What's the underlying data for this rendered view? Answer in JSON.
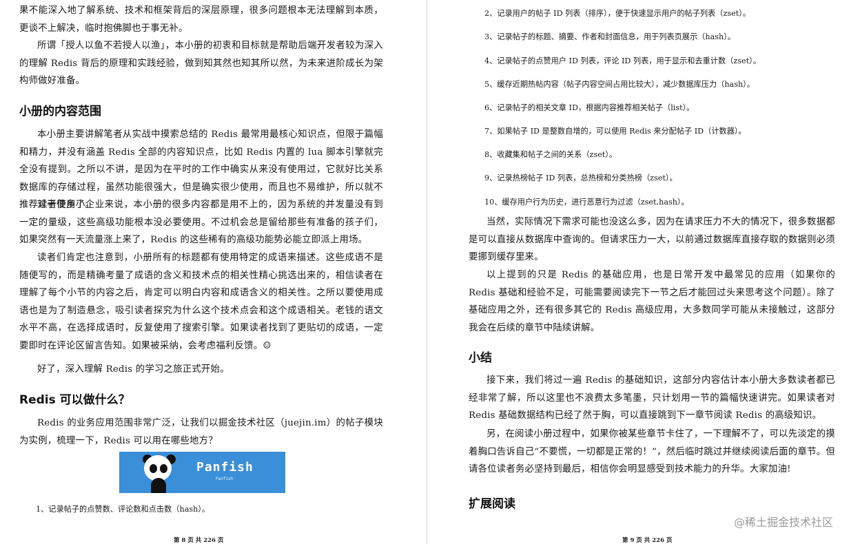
{
  "left": {
    "p1": "果不能深入地了解系统、技术和框架背后的深层原理，很多问题根本无法理解到本质，更谈不上解决，临时抱佛脚也于事无补。",
    "p2": "所谓「授人以鱼不若授人以渔」，本小册的初衷和目标就是帮助后端开发者较为深入的理解 Redis 背后的原理和实践经验，做到知其然也知其所以然，为未来进阶成长为架构师做好准备。",
    "h_scope": "小册的内容范围",
    "p3": "本小册主要讲解笔者从实战中摸索总结的 Redis 最常用最核心知识点，但限于篇幅和精力，并没有涵盖 Redis 全部的内容知识点，比如 Redis 内置的 lua 脚本引擎就完全没有提到。之所以不讲，是因为在平时的工作中确实从来没有使用过，它就好比关系数据库的存储过程，虽然功能很强大，但是确实很少使用，而且也不易维护，所以就不推荐读者使用了。",
    "p4": "对于很多小企业来说，本小册的很多内容都是用不上的，因为系统的并发量没有到一定的量级，这些高级功能根本没必要使用。不过机会总是留给那些有准备的孩子们，如果突然有一天流量涨上来了，Redis 的这些稀有的高级功能势必能立即派上用场。",
    "p5": "读者们肯定也注意到，小册所有的标题都有使用特定的成语来描述。这些成语不是随便写的，而是精确考量了成语的含义和技术点的相关性精心挑选出来的，相信读者在理解了每个小节的内容之后，肯定可以明白内容和成语含义的相关性。之所以要使用成语也是为了制造悬念，吸引读者探究为什么这个技术点会和这个成语相关。老钱的语文水平不高，在选择成语时，反复使用了搜索引擎。如果读者找到了更贴切的成语，一定要即时在评论区留言告知。如果被采纳，会考虑福利反馈。☺",
    "p6": "好了，深入理解 Redis 的学习之旅正式开始。",
    "h_usage": "Redis 可以做什么？",
    "p7": "Redis 的业务应用范围非常广泛，让我们以掘金技术社区（juejin.im）的帖子模块为实例，梳理一下，Redis 可以用在哪些地方？",
    "banner_brand": "Panfish",
    "banner_sub": "Panfish",
    "item1": "1、记录帖子的点赞数、评论数和点击数（hash）。",
    "page_num": "第 8 页 共 226 页"
  },
  "right": {
    "items": [
      "2、记录用户的帖子 ID 列表（排序），便于快速显示用户的帖子列表（zset）。",
      "3、记录帖子的标题、摘要、作者和封面信息，用于列表页展示（hash）。",
      "4、记录帖子的点赞用户 ID 列表，评论 ID 列表，用于显示和去重计数（zset）。",
      "5、缓存近期热帖内容（帖子内容空间占用比较大），减少数据库压力（hash）。",
      "6、记录帖子的相关文章 ID，根据内容推荐相关帖子（list）。",
      "7、如果帖子 ID 是整数自增的，可以使用 Redis 来分配帖子 ID（计数器）。",
      "8、收藏集和帖子之间的关系（zset）。",
      "9、记录热榜帖子 ID 列表，总热榜和分类热榜（zset）。",
      "10、缓存用户行为历史，进行恶意行为过滤（zset,hash）。"
    ],
    "p1": "当然，实际情况下需求可能也没这么多，因为在请求压力不大的情况下，很多数据都是可以直接从数据库中查询的。但请求压力一大，以前通过数据库直接存取的数据则必须要挪到缓存里来。",
    "p2": "以上提到的只是 Redis 的基础应用，也是日常开发中最常见的应用（如果你的 Redis 基础和经验不足，可能需要阅读完下一节之后才能回过头来思考这个问题）。除了基础应用之外，还有很多其它的 Redis 高级应用，大多数同学可能从未接触过，这部分我会在后续的章节中陆续讲解。",
    "h_summary": "小结",
    "p3": "接下来，我们将过一遍 Redis 的基础知识，这部分内容估计本小册大多数读者都已经非常了解，所以这里也不浪费太多笔墨，只计划用一节的篇幅快速讲完。如果读者对 Redis 基础数据结构已经了然于胸，可以直接跳到下一章节阅读 Redis 的高级知识。",
    "p4": "另，在阅读小册过程中，如果你被某些章节卡住了，一下理解不了，可以先淡定的摸着胸口告诉自己“不要慌，一切都是正常的！”，然后临时跳过并继续阅读后面的章节。但请各位读者务必坚持到最后，相信你会明显感受到技术能力的升华。大家加油!",
    "h_further": "扩展阅读",
    "page_num": "第 9 页 共 226 页"
  },
  "watermark": "@稀土掘金技术社区",
  "colors": {
    "banner_bg": "#3b8fd9",
    "text": "#1a1a1a",
    "watermark": "#9a9a9a"
  }
}
